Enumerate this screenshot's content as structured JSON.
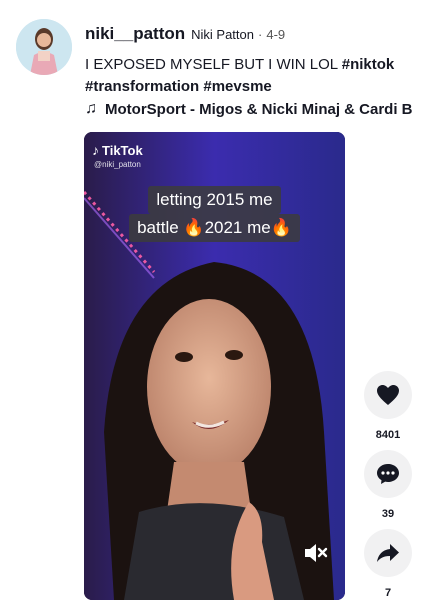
{
  "post": {
    "username": "niki__patton",
    "nickname": "Niki Patton",
    "separator": "·",
    "date": "4-9",
    "caption_text": "I EXPOSED MYSELF BUT I WIN LOL ",
    "hashtags": [
      "#niktok",
      "#transformation",
      "#mevsme"
    ],
    "music_icon": "music-note-icon",
    "music": "MotorSport - Migos & Nicki Minaj & Cardi B"
  },
  "video": {
    "watermark_brand": "TikTok",
    "watermark_handle": "@niki_patton",
    "overlay_line1": "letting 2015 me",
    "overlay_line2": "battle 🔥2021 me🔥",
    "mute_icon": "volume-mute-icon"
  },
  "actions": {
    "like": {
      "icon": "heart-icon",
      "count": "8401"
    },
    "comment": {
      "icon": "comment-icon",
      "count": "39"
    },
    "share": {
      "icon": "share-icon",
      "count": "7"
    }
  }
}
